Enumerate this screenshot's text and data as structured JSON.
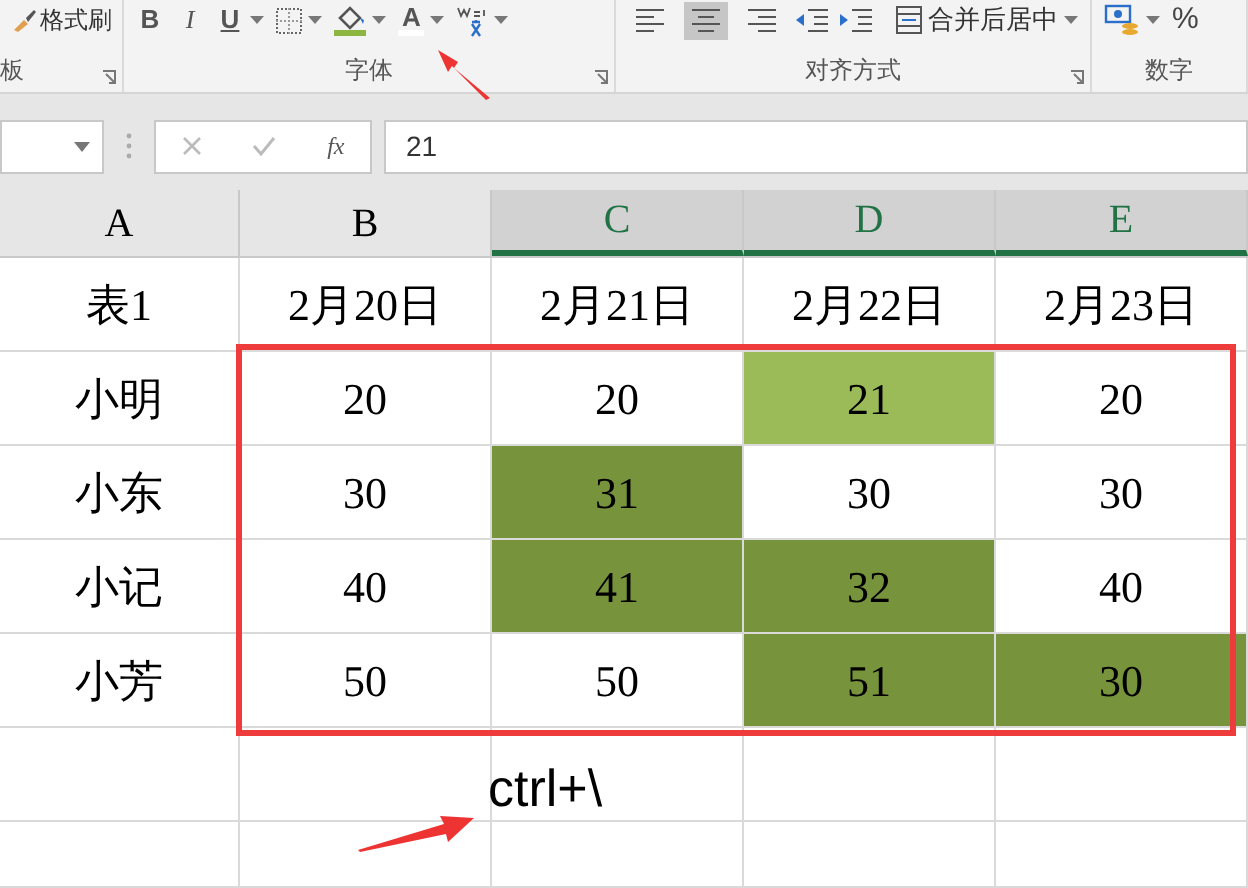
{
  "ribbon": {
    "groups": [
      {
        "label": "板",
        "items": [
          {
            "kind": "brush",
            "text": "格式刷"
          }
        ]
      },
      {
        "label": "字体",
        "items": [
          {
            "kind": "bold",
            "text": "B"
          },
          {
            "kind": "italic",
            "text": "I"
          },
          {
            "kind": "underline",
            "text": "U"
          },
          {
            "kind": "border"
          },
          {
            "kind": "fill"
          },
          {
            "kind": "fontcolor",
            "text": "A"
          },
          {
            "kind": "pinyin"
          }
        ]
      },
      {
        "label": "对齐方式",
        "items": [
          {
            "kind": "alignleft",
            "selected": false
          },
          {
            "kind": "aligncenter",
            "selected": true
          },
          {
            "kind": "alignright",
            "selected": false
          },
          {
            "kind": "outdent"
          },
          {
            "kind": "indent"
          },
          {
            "kind": "merge",
            "text": "合并后居中"
          }
        ]
      },
      {
        "label": "数字",
        "items": [
          {
            "kind": "currency"
          },
          {
            "kind": "percent",
            "text": "%"
          }
        ]
      }
    ]
  },
  "formula_bar": {
    "function_label": "fx",
    "value": "21"
  },
  "columns": [
    {
      "label": "A",
      "selected": false
    },
    {
      "label": "B",
      "selected": false
    },
    {
      "label": "C",
      "selected": true
    },
    {
      "label": "D",
      "selected": true
    },
    {
      "label": "E",
      "selected": true
    }
  ],
  "rows": [
    [
      {
        "text": "表1"
      },
      {
        "text": "2月20日"
      },
      {
        "text": "2月21日"
      },
      {
        "text": "2月22日"
      },
      {
        "text": "2月23日"
      }
    ],
    [
      {
        "text": "小明"
      },
      {
        "text": "20"
      },
      {
        "text": "20"
      },
      {
        "text": "21",
        "color": "#9bbb59"
      },
      {
        "text": "20"
      }
    ],
    [
      {
        "text": "小东"
      },
      {
        "text": "30"
      },
      {
        "text": "31",
        "color": "#77933c"
      },
      {
        "text": "30"
      },
      {
        "text": "30"
      }
    ],
    [
      {
        "text": "小记"
      },
      {
        "text": "40"
      },
      {
        "text": "41",
        "color": "#77933c"
      },
      {
        "text": "32",
        "color": "#77933c"
      },
      {
        "text": "40"
      }
    ],
    [
      {
        "text": "小芳"
      },
      {
        "text": "50"
      },
      {
        "text": "50"
      },
      {
        "text": "51",
        "color": "#77933c"
      },
      {
        "text": "30",
        "color": "#77933c"
      }
    ]
  ],
  "annotation": {
    "text": "ctrl+\\"
  }
}
